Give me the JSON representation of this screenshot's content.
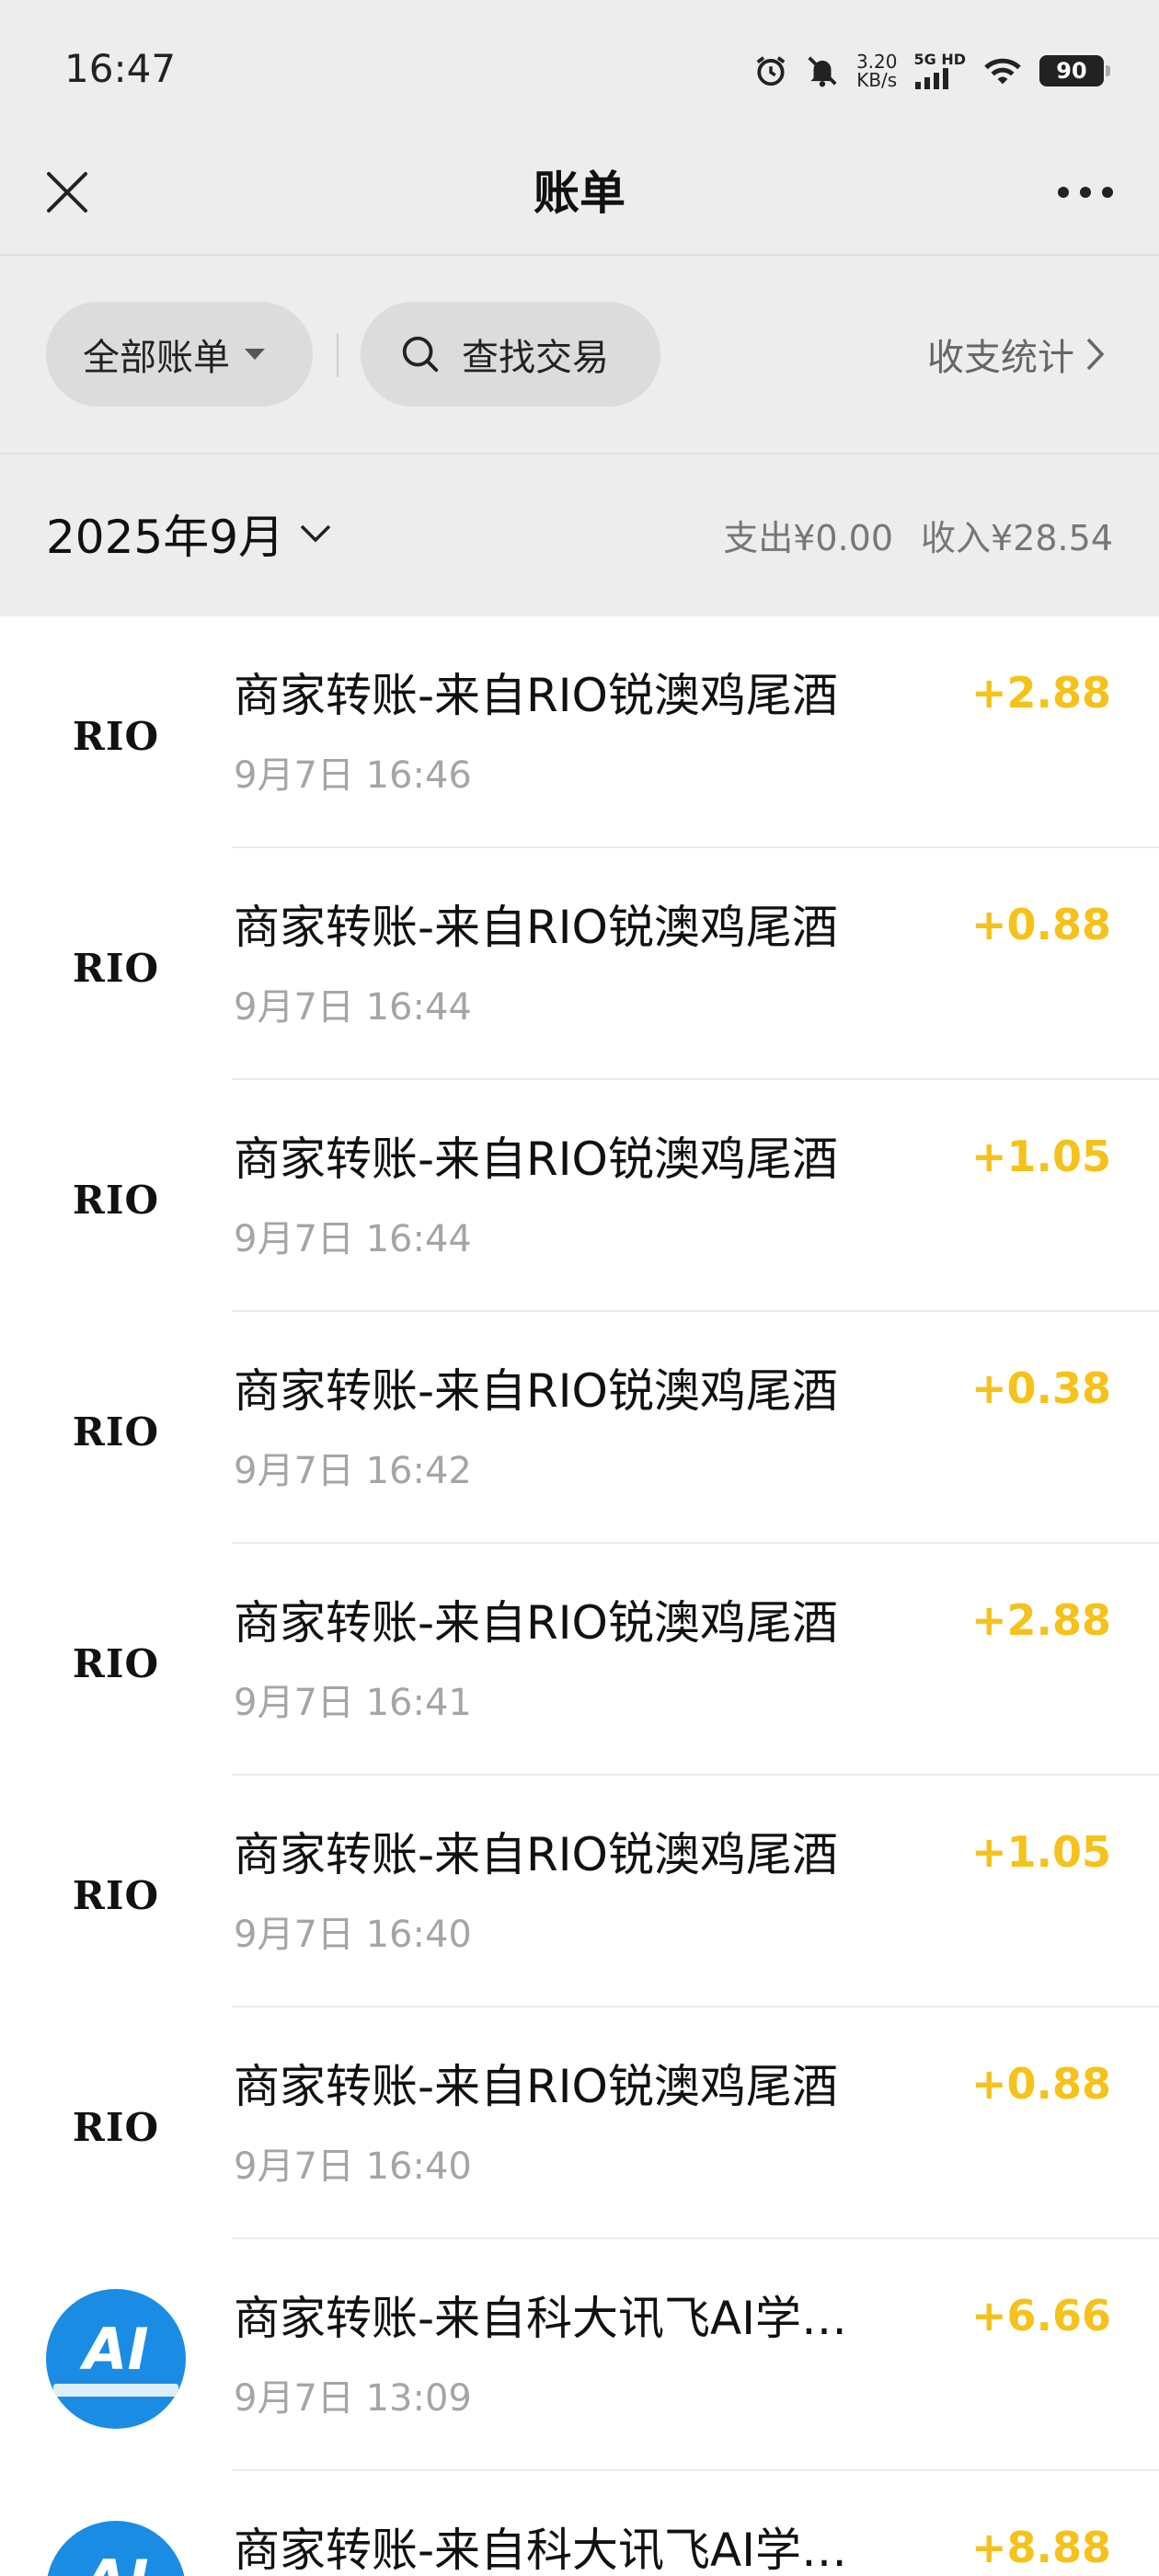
{
  "status_bar": {
    "time": "16:47",
    "net_speed_value": "3.20",
    "net_speed_unit": "KB/s",
    "network_label": "5G HD",
    "battery": "90"
  },
  "nav": {
    "title": "账单",
    "close_icon": "close-icon",
    "more_icon": "more-icon"
  },
  "toolbar": {
    "all_bills": "全部账单",
    "search": "查找交易",
    "stats": "收支统计"
  },
  "month": {
    "label": "2025年9月",
    "expense": "支出¥0.00",
    "income": "收入¥28.54"
  },
  "colors": {
    "income_amount": "#f5c21b",
    "ai_logo_blue": "#1b8ce4"
  },
  "transactions": [
    {
      "logo": "RIO",
      "title": "商家转账-来自RIO锐澳鸡尾酒",
      "time": "9月7日 16:46",
      "amount": "+2.88"
    },
    {
      "logo": "RIO",
      "title": "商家转账-来自RIO锐澳鸡尾酒",
      "time": "9月7日 16:44",
      "amount": "+0.88"
    },
    {
      "logo": "RIO",
      "title": "商家转账-来自RIO锐澳鸡尾酒",
      "time": "9月7日 16:44",
      "amount": "+1.05"
    },
    {
      "logo": "RIO",
      "title": "商家转账-来自RIO锐澳鸡尾酒",
      "time": "9月7日 16:42",
      "amount": "+0.38"
    },
    {
      "logo": "RIO",
      "title": "商家转账-来自RIO锐澳鸡尾酒",
      "time": "9月7日 16:41",
      "amount": "+2.88"
    },
    {
      "logo": "RIO",
      "title": "商家转账-来自RIO锐澳鸡尾酒",
      "time": "9月7日 16:40",
      "amount": "+1.05"
    },
    {
      "logo": "RIO",
      "title": "商家转账-来自RIO锐澳鸡尾酒",
      "time": "9月7日 16:40",
      "amount": "+0.88"
    },
    {
      "logo": "AI",
      "title": "商家转账-来自科大讯飞AI学…",
      "time": "9月7日 13:09",
      "amount": "+6.66"
    },
    {
      "logo": "AI",
      "title": "商家转账-来自科大讯飞AI学…",
      "time": "",
      "amount": "+8.88"
    }
  ]
}
